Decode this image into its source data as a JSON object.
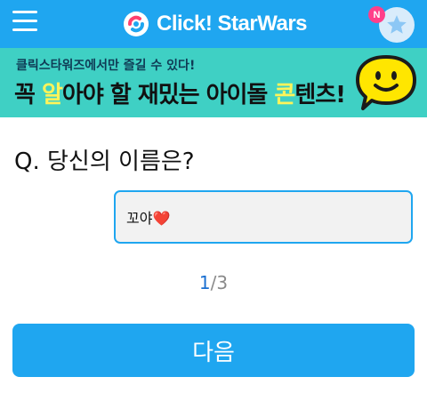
{
  "header": {
    "app_name": "Click! StarWars",
    "notification_badge": "N",
    "colors": {
      "bar": "#1fa6f0",
      "badge": "#ff3f8a"
    }
  },
  "banner": {
    "subtitle": "클릭스타워즈에서만 즐길 수 있다!",
    "headline_1": "꼭 ",
    "headline_hl1": "알",
    "headline_2": "아야 할 재밌는 아이돌 ",
    "headline_hl2": "콘",
    "headline_3": "텐츠!",
    "background": "#3fd0c4"
  },
  "quiz": {
    "question": "Q. 당신의 이름은?",
    "answer_value": "꼬야❤️",
    "page_current": "1",
    "page_separator": "/",
    "page_total": "3",
    "next_label": "다음"
  },
  "icons": [
    "menu-icon",
    "logo-icon",
    "star-icon",
    "smiley-icon"
  ]
}
